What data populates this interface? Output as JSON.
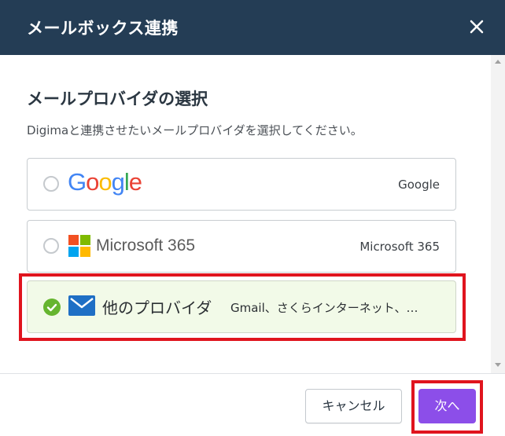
{
  "dialog": {
    "title": "メールボックス連携",
    "close_icon": "close-icon"
  },
  "content": {
    "section_title": "メールプロバイダの選択",
    "description": "Digimaと連携させたいメールプロバイダを選択してください。"
  },
  "providers": [
    {
      "logo_text": "Google",
      "right_label": "Google",
      "selected": false
    },
    {
      "logo_text": "Microsoft 365",
      "right_label": "Microsoft 365",
      "selected": false
    },
    {
      "logo_text": "他のプロバイダ",
      "right_label": "Gmail、さくらインターネット、…",
      "selected": true
    }
  ],
  "footer": {
    "cancel_label": "キャンセル",
    "next_label": "次へ"
  },
  "colors": {
    "header_bg": "#243d55",
    "selected_bg": "#f2fae8",
    "check_green": "#66b52f",
    "next_button": "#8c4ee9",
    "highlight_red": "#e0141e"
  }
}
